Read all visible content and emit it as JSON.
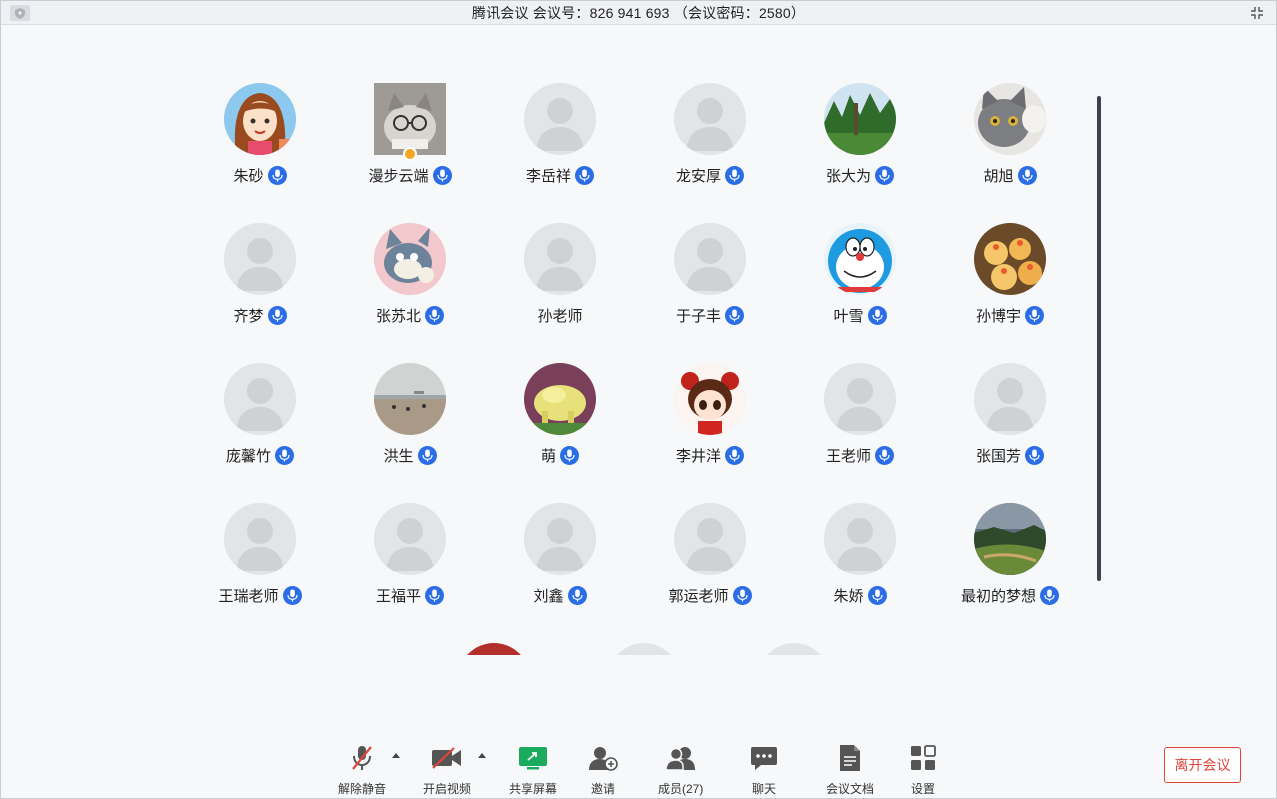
{
  "window": {
    "title": "腾讯会议  会议号：826 941 693 （会议密码：2580）"
  },
  "participants": [
    [
      {
        "name": "朱砂",
        "avatar": "girl-cartoon-avatar"
      },
      {
        "name": "漫步云端",
        "avatar": "cat-glasses-avatar",
        "host": true
      },
      {
        "name": "李岳祥",
        "avatar": "default-avatar"
      },
      {
        "name": "龙安厚",
        "avatar": "default-avatar"
      },
      {
        "name": "张大为",
        "avatar": "forest-photo-avatar"
      },
      {
        "name": "胡旭",
        "avatar": "grey-cat-avatar"
      }
    ],
    [
      {
        "name": "齐梦",
        "avatar": "default-avatar"
      },
      {
        "name": "张苏北",
        "avatar": "tom-cat-avatar"
      },
      {
        "name": "孙老师",
        "avatar": "default-avatar",
        "no_mic": true
      },
      {
        "name": "于子丰",
        "avatar": "default-avatar"
      },
      {
        "name": "叶雪",
        "avatar": "doraemon-avatar"
      },
      {
        "name": "孙博宇",
        "avatar": "cupcakes-avatar"
      }
    ],
    [
      {
        "name": "庞馨竹",
        "avatar": "default-avatar"
      },
      {
        "name": "洪生",
        "avatar": "beach-photo-avatar"
      },
      {
        "name": "萌",
        "avatar": "toy-photo-avatar"
      },
      {
        "name": "李井洋",
        "avatar": "chinese-girl-avatar"
      },
      {
        "name": "王老师",
        "avatar": "default-avatar"
      },
      {
        "name": "张国芳",
        "avatar": "default-avatar"
      }
    ],
    [
      {
        "name": "王瑞老师",
        "avatar": "default-avatar"
      },
      {
        "name": "王福平",
        "avatar": "default-avatar"
      },
      {
        "name": "刘鑫",
        "avatar": "default-avatar"
      },
      {
        "name": "郭运老师",
        "avatar": "default-avatar"
      },
      {
        "name": "朱娇",
        "avatar": "default-avatar"
      },
      {
        "name": "最初的梦想",
        "avatar": "landscape-photo-avatar"
      }
    ]
  ],
  "toolbar": {
    "unmute": "解除静音",
    "start_video": "开启视频",
    "share_screen": "共享屏幕",
    "invite": "邀请",
    "members": "成员(27)",
    "chat": "聊天",
    "docs": "会议文档",
    "settings": "设置",
    "leave": "离开会议"
  },
  "colors": {
    "accent_blue": "#2b6de5",
    "share_green": "#1aab5f",
    "leave_red": "#e0453a",
    "muted_red": "#e0453a"
  }
}
